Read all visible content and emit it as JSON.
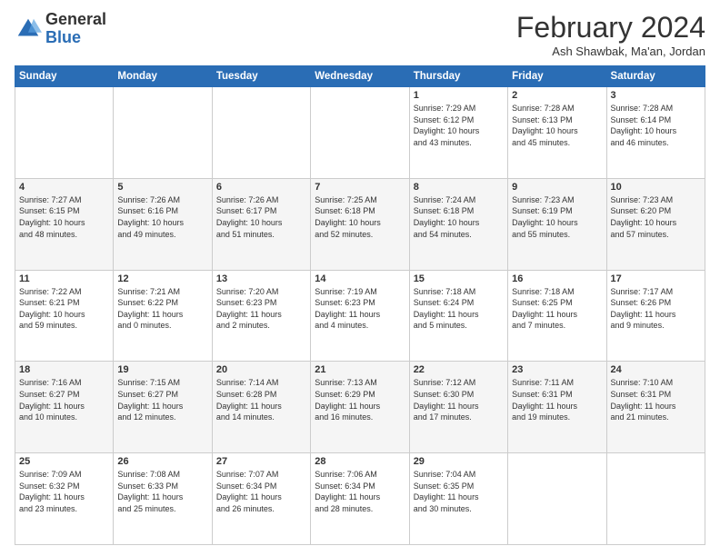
{
  "logo": {
    "general": "General",
    "blue": "Blue"
  },
  "title": "February 2024",
  "location": "Ash Shawbak, Ma'an, Jordan",
  "days_of_week": [
    "Sunday",
    "Monday",
    "Tuesday",
    "Wednesday",
    "Thursday",
    "Friday",
    "Saturday"
  ],
  "weeks": [
    [
      {
        "day": "",
        "info": ""
      },
      {
        "day": "",
        "info": ""
      },
      {
        "day": "",
        "info": ""
      },
      {
        "day": "",
        "info": ""
      },
      {
        "day": "1",
        "info": "Sunrise: 7:29 AM\nSunset: 6:12 PM\nDaylight: 10 hours\nand 43 minutes."
      },
      {
        "day": "2",
        "info": "Sunrise: 7:28 AM\nSunset: 6:13 PM\nDaylight: 10 hours\nand 45 minutes."
      },
      {
        "day": "3",
        "info": "Sunrise: 7:28 AM\nSunset: 6:14 PM\nDaylight: 10 hours\nand 46 minutes."
      }
    ],
    [
      {
        "day": "4",
        "info": "Sunrise: 7:27 AM\nSunset: 6:15 PM\nDaylight: 10 hours\nand 48 minutes."
      },
      {
        "day": "5",
        "info": "Sunrise: 7:26 AM\nSunset: 6:16 PM\nDaylight: 10 hours\nand 49 minutes."
      },
      {
        "day": "6",
        "info": "Sunrise: 7:26 AM\nSunset: 6:17 PM\nDaylight: 10 hours\nand 51 minutes."
      },
      {
        "day": "7",
        "info": "Sunrise: 7:25 AM\nSunset: 6:18 PM\nDaylight: 10 hours\nand 52 minutes."
      },
      {
        "day": "8",
        "info": "Sunrise: 7:24 AM\nSunset: 6:18 PM\nDaylight: 10 hours\nand 54 minutes."
      },
      {
        "day": "9",
        "info": "Sunrise: 7:23 AM\nSunset: 6:19 PM\nDaylight: 10 hours\nand 55 minutes."
      },
      {
        "day": "10",
        "info": "Sunrise: 7:23 AM\nSunset: 6:20 PM\nDaylight: 10 hours\nand 57 minutes."
      }
    ],
    [
      {
        "day": "11",
        "info": "Sunrise: 7:22 AM\nSunset: 6:21 PM\nDaylight: 10 hours\nand 59 minutes."
      },
      {
        "day": "12",
        "info": "Sunrise: 7:21 AM\nSunset: 6:22 PM\nDaylight: 11 hours\nand 0 minutes."
      },
      {
        "day": "13",
        "info": "Sunrise: 7:20 AM\nSunset: 6:23 PM\nDaylight: 11 hours\nand 2 minutes."
      },
      {
        "day": "14",
        "info": "Sunrise: 7:19 AM\nSunset: 6:23 PM\nDaylight: 11 hours\nand 4 minutes."
      },
      {
        "day": "15",
        "info": "Sunrise: 7:18 AM\nSunset: 6:24 PM\nDaylight: 11 hours\nand 5 minutes."
      },
      {
        "day": "16",
        "info": "Sunrise: 7:18 AM\nSunset: 6:25 PM\nDaylight: 11 hours\nand 7 minutes."
      },
      {
        "day": "17",
        "info": "Sunrise: 7:17 AM\nSunset: 6:26 PM\nDaylight: 11 hours\nand 9 minutes."
      }
    ],
    [
      {
        "day": "18",
        "info": "Sunrise: 7:16 AM\nSunset: 6:27 PM\nDaylight: 11 hours\nand 10 minutes."
      },
      {
        "day": "19",
        "info": "Sunrise: 7:15 AM\nSunset: 6:27 PM\nDaylight: 11 hours\nand 12 minutes."
      },
      {
        "day": "20",
        "info": "Sunrise: 7:14 AM\nSunset: 6:28 PM\nDaylight: 11 hours\nand 14 minutes."
      },
      {
        "day": "21",
        "info": "Sunrise: 7:13 AM\nSunset: 6:29 PM\nDaylight: 11 hours\nand 16 minutes."
      },
      {
        "day": "22",
        "info": "Sunrise: 7:12 AM\nSunset: 6:30 PM\nDaylight: 11 hours\nand 17 minutes."
      },
      {
        "day": "23",
        "info": "Sunrise: 7:11 AM\nSunset: 6:31 PM\nDaylight: 11 hours\nand 19 minutes."
      },
      {
        "day": "24",
        "info": "Sunrise: 7:10 AM\nSunset: 6:31 PM\nDaylight: 11 hours\nand 21 minutes."
      }
    ],
    [
      {
        "day": "25",
        "info": "Sunrise: 7:09 AM\nSunset: 6:32 PM\nDaylight: 11 hours\nand 23 minutes."
      },
      {
        "day": "26",
        "info": "Sunrise: 7:08 AM\nSunset: 6:33 PM\nDaylight: 11 hours\nand 25 minutes."
      },
      {
        "day": "27",
        "info": "Sunrise: 7:07 AM\nSunset: 6:34 PM\nDaylight: 11 hours\nand 26 minutes."
      },
      {
        "day": "28",
        "info": "Sunrise: 7:06 AM\nSunset: 6:34 PM\nDaylight: 11 hours\nand 28 minutes."
      },
      {
        "day": "29",
        "info": "Sunrise: 7:04 AM\nSunset: 6:35 PM\nDaylight: 11 hours\nand 30 minutes."
      },
      {
        "day": "",
        "info": ""
      },
      {
        "day": "",
        "info": ""
      }
    ]
  ]
}
